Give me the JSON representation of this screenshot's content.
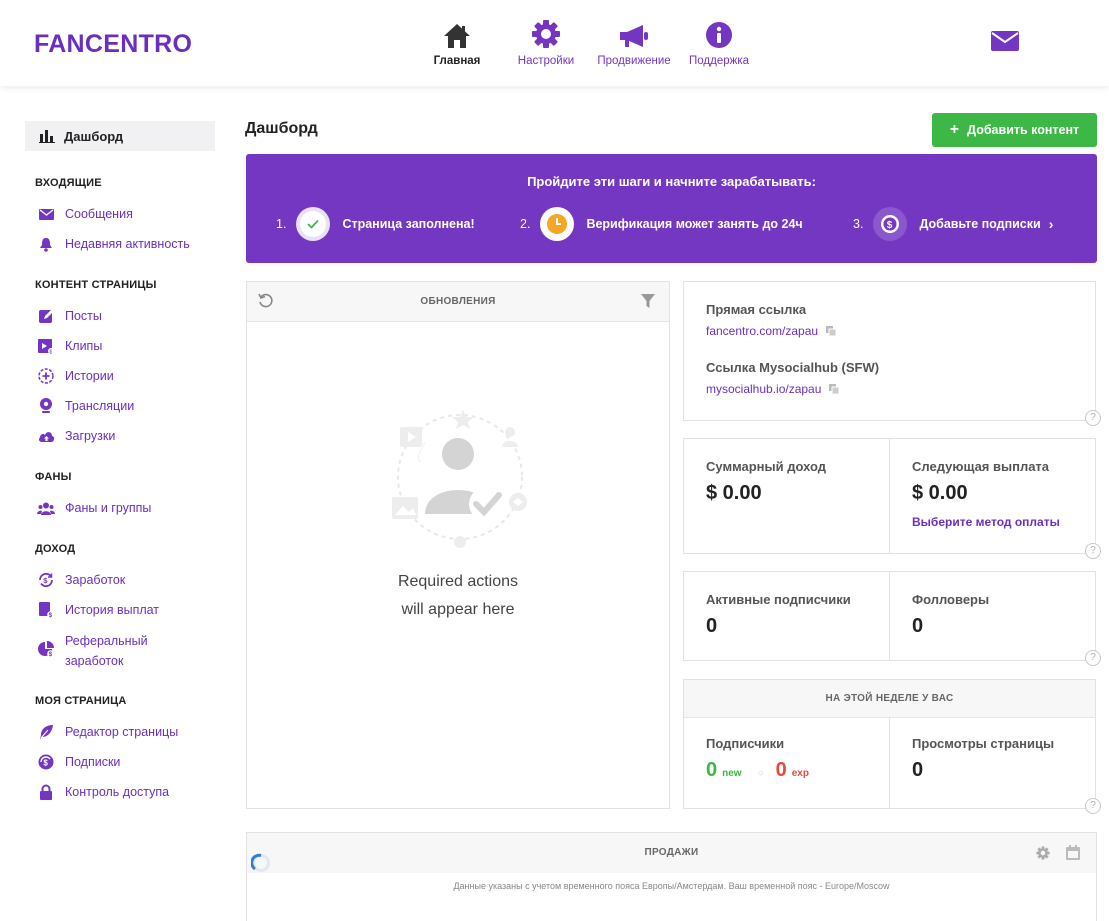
{
  "header": {
    "logo": "FANCENTRO",
    "nav": [
      {
        "label": "Главная",
        "icon": "home-icon"
      },
      {
        "label": "Настройки",
        "icon": "gear-icon"
      },
      {
        "label": "Продвижение",
        "icon": "megaphone-icon"
      },
      {
        "label": "Поддержка",
        "icon": "info-icon"
      }
    ],
    "mail_icon": "envelope-icon"
  },
  "sidebar": {
    "dashboard": "Дашборд",
    "sections": [
      {
        "title": "ВХОДЯЩИЕ",
        "items": [
          {
            "label": "Сообщения",
            "icon": "envelope-icon"
          },
          {
            "label": "Недавняя активность",
            "icon": "bell-icon"
          }
        ]
      },
      {
        "title": "КОНТЕНТ СТРАНИЦЫ",
        "items": [
          {
            "label": "Посты",
            "icon": "edit-icon"
          },
          {
            "label": "Клипы",
            "icon": "clip-icon"
          },
          {
            "label": "Истории",
            "icon": "stories-icon"
          },
          {
            "label": "Трансляции",
            "icon": "broadcast-icon"
          },
          {
            "label": "Загрузки",
            "icon": "upload-cloud-icon"
          }
        ]
      },
      {
        "title": "ФАНЫ",
        "items": [
          {
            "label": "Фаны и группы",
            "icon": "users-icon"
          }
        ]
      },
      {
        "title": "ДОХОД",
        "items": [
          {
            "label": "Заработок",
            "icon": "earnings-icon"
          },
          {
            "label": "История выплат",
            "icon": "payout-history-icon"
          },
          {
            "label": "Реферальный заработок",
            "icon": "referral-icon"
          }
        ]
      },
      {
        "title": "МОЯ СТРАНИЦА",
        "items": [
          {
            "label": "Редактор страницы",
            "icon": "feather-icon"
          },
          {
            "label": "Подписки",
            "icon": "subscriptions-icon"
          },
          {
            "label": "Контроль доступа",
            "icon": "lock-icon"
          }
        ]
      }
    ]
  },
  "main": {
    "title": "Дашборд",
    "add_button": "Добавить контент",
    "banner": {
      "title": "Пройдите эти шаги и начните зарабатывать:",
      "steps": [
        {
          "num": "1.",
          "label": "Страница заполнена!"
        },
        {
          "num": "2.",
          "label": "Верификация может занять до 24ч"
        },
        {
          "num": "3.",
          "label": "Добавьте подписки"
        }
      ]
    },
    "updates": {
      "title": "ОБНОВЛЕНИЯ",
      "empty_line1": "Required actions",
      "empty_line2": "will appear here"
    },
    "links": {
      "direct_label": "Прямая ссылка",
      "direct_url": "fancentro.com/zapau",
      "sfw_label": "Ссылка Mysocialhub (SFW)",
      "sfw_url": "mysocialhub.io/zapau"
    },
    "income": {
      "total_label": "Суммарный доход",
      "total_value": "$ 0.00",
      "next_label": "Следующая выплата",
      "next_value": "$ 0.00",
      "payment_link": "Выберите метод оплаты"
    },
    "audience": {
      "active_label": "Активные подписчики",
      "active_value": "0",
      "followers_label": "Фолловеры",
      "followers_value": "0"
    },
    "week": {
      "title": "НА ЭТОЙ НЕДЕЛЕ У ВАС",
      "subs_label": "Подписчики",
      "new_value": "0",
      "new_label": "new",
      "exp_value": "0",
      "exp_label": "exp",
      "views_label": "Просмотры страницы",
      "views_value": "0"
    },
    "sales": {
      "title": "ПРОДАЖИ",
      "timezone_note": "Данные указаны с учетом временного пояса Европы/Амстердам. Ваш временной пояс -  Europe/Moscow"
    },
    "help": "?"
  },
  "colors": {
    "brand": "#7437c2",
    "green": "#3db846",
    "red": "#e0493b"
  }
}
